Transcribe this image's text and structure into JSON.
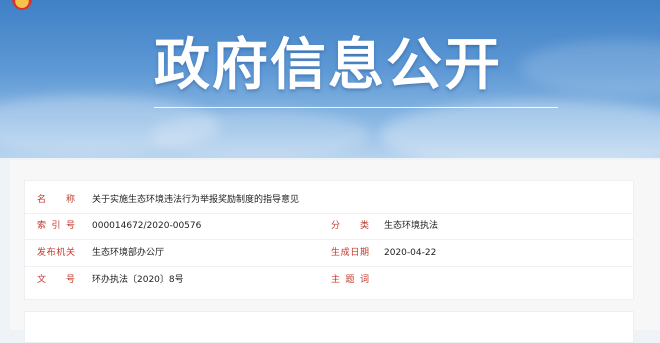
{
  "banner": {
    "title": "政府信息公开"
  },
  "info": {
    "name_label": "名　　称",
    "name_value": "关于实施生态环境违法行为举报奖励制度的指导意见",
    "index_label": "索 引 号",
    "index_value": "000014672/2020-00576",
    "category_label": "分　　类",
    "category_value": "生态环境执法",
    "issuer_label": "发布机关",
    "issuer_value": "生态环境部办公厅",
    "date_label": "生成日期",
    "date_value": "2020-04-22",
    "docno_label": "文　　号",
    "docno_value": "环办执法〔2020〕8号",
    "keywords_label": "主 题 词",
    "keywords_value": ""
  },
  "colors": {
    "label": "#c0392b",
    "banner_top": "#3f80c6"
  }
}
